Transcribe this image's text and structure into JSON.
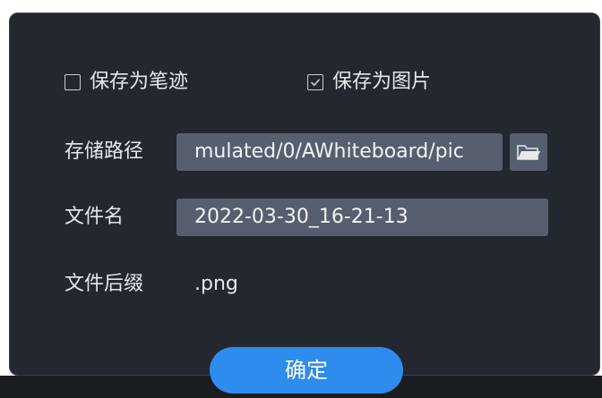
{
  "dialog": {
    "save_as_strokes": {
      "label": "保存为笔迹",
      "checked": false
    },
    "save_as_image": {
      "label": "保存为图片",
      "checked": true
    },
    "storage_path": {
      "label": "存储路径",
      "value": "mulated/0/AWhiteboard/pic",
      "browse_icon": "folder-open-icon"
    },
    "file_name": {
      "label": "文件名",
      "value": "2022-03-30_16-21-13"
    },
    "file_extension": {
      "label": "文件后缀",
      "value": ".png"
    },
    "confirm_label": "确定"
  },
  "colors": {
    "dialog_background": "#23272f",
    "field_background": "#575e6d",
    "accent": "#2f8cef",
    "text": "#e6e8eb"
  }
}
